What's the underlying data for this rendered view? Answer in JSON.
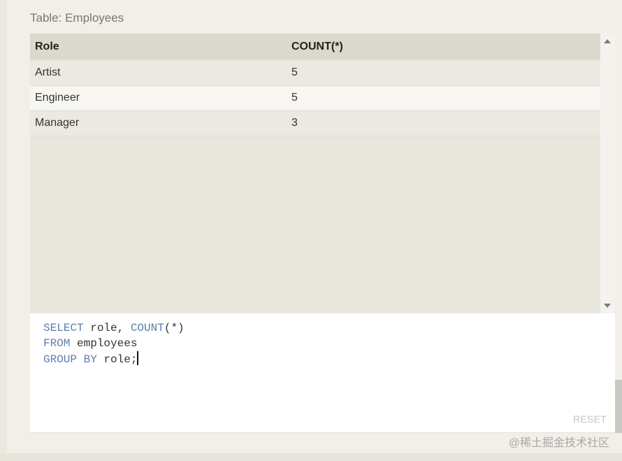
{
  "table_title": "Table: Employees",
  "results": {
    "columns": [
      "Role",
      "COUNT(*)"
    ],
    "rows": [
      [
        "Artist",
        "5"
      ],
      [
        "Engineer",
        "5"
      ],
      [
        "Manager",
        "3"
      ]
    ]
  },
  "editor": {
    "line1": {
      "kw1": "SELECT",
      "t1": " role, ",
      "kw2": "COUNT",
      "t2": "(*)"
    },
    "line2": {
      "kw1": "FROM",
      "t1": " employees"
    },
    "line3": {
      "kw1": "GROUP BY",
      "t1": " role;"
    }
  },
  "reset_label": "RESET",
  "watermark": "@稀土掘金技术社区",
  "colors": {
    "sql_keyword": "#5d7dad",
    "header_bg": "#dbd9ce",
    "pane_bg": "#e8e6dd"
  }
}
